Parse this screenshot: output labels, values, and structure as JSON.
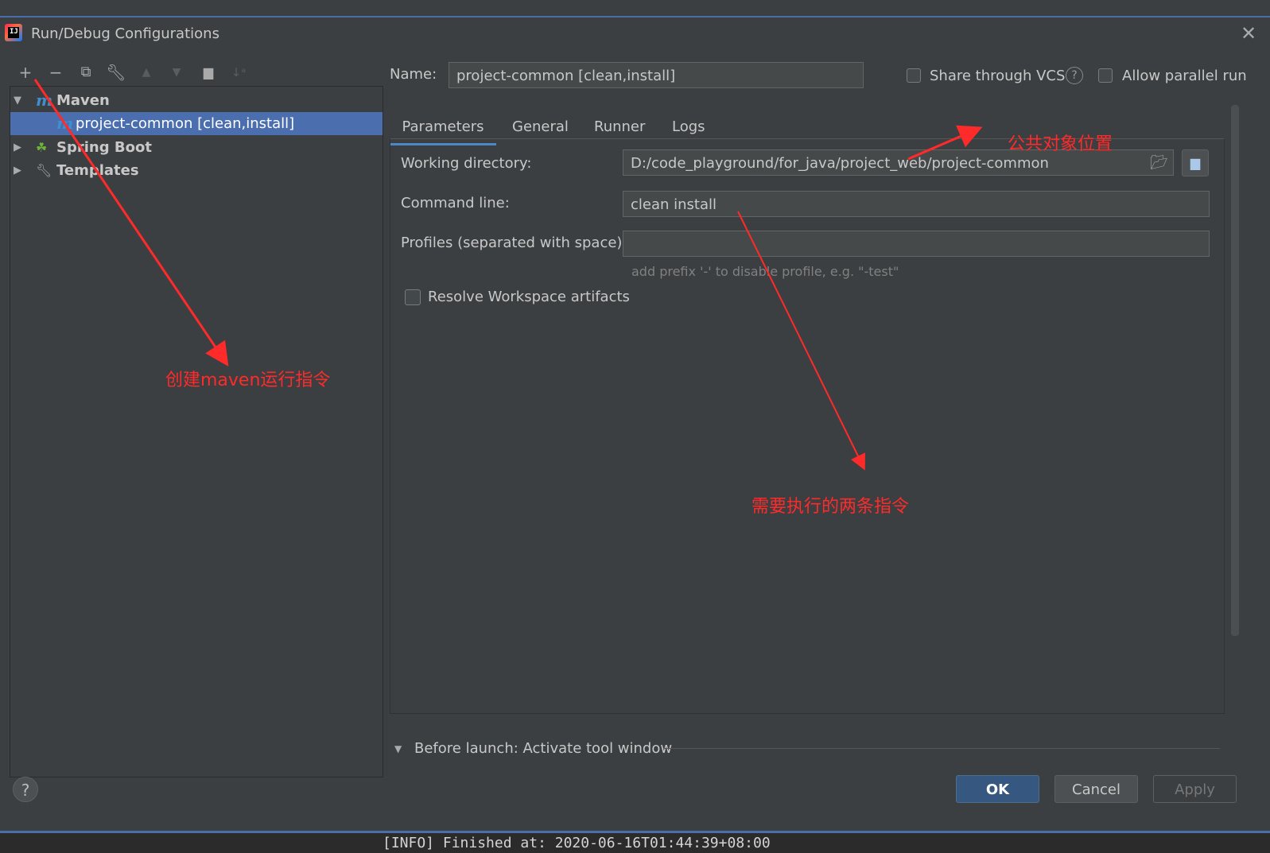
{
  "window": {
    "title": "Run/Debug Configurations"
  },
  "tree": {
    "items": [
      {
        "label": "Maven",
        "level": 0,
        "expanded": true,
        "icon": "maven-icon"
      },
      {
        "label": "project-common [clean,install]",
        "level": 1,
        "selected": true,
        "icon": "maven-icon"
      },
      {
        "label": "Spring Boot",
        "level": 0,
        "expanded": false,
        "icon": "spring-boot-icon"
      },
      {
        "label": "Templates",
        "level": 0,
        "expanded": false,
        "icon": "wrench-icon"
      }
    ]
  },
  "toolbar": [
    "add-icon",
    "remove-icon",
    "copy-icon",
    "wrench-icon",
    "move-up-icon",
    "move-down-icon",
    "new-folder-icon",
    "sort-icon"
  ],
  "name": {
    "label": "Name:",
    "value": "project-common [clean,install]"
  },
  "share_vcs": {
    "label": "Share through VCS",
    "checked": false
  },
  "allow_parallel": {
    "label": "Allow parallel run",
    "checked": false
  },
  "tabs": [
    {
      "label": "Parameters",
      "active": true
    },
    {
      "label": "General",
      "active": false
    },
    {
      "label": "Runner",
      "active": false
    },
    {
      "label": "Logs",
      "active": false
    }
  ],
  "params": {
    "working_dir_label": "Working directory:",
    "working_dir_value": "D:/code_playground/for_java/project_web/project-common",
    "command_line_label": "Command line:",
    "command_line_value": "clean install",
    "profiles_label": "Profiles (separated with space):",
    "profiles_value": "",
    "profiles_hint": "add prefix '-' to disable profile, e.g. \"-test\"",
    "resolve_label": "Resolve Workspace artifacts",
    "resolve_checked": false
  },
  "before_launch": {
    "label": "Before launch: Activate tool window"
  },
  "buttons": {
    "ok": "OK",
    "cancel": "Cancel",
    "apply": "Apply",
    "help": "?"
  },
  "console_line": "[INFO] Finished at: 2020-06-16T01:44:39+08:00",
  "annotations": {
    "create_maven": "创建maven运行指令",
    "public_location": "公共对象位置",
    "two_commands": "需要执行的两条指令"
  },
  "colors": {
    "accent": "#4b6eaf",
    "annotation": "#ff2a2a",
    "background": "#3c3f41"
  }
}
